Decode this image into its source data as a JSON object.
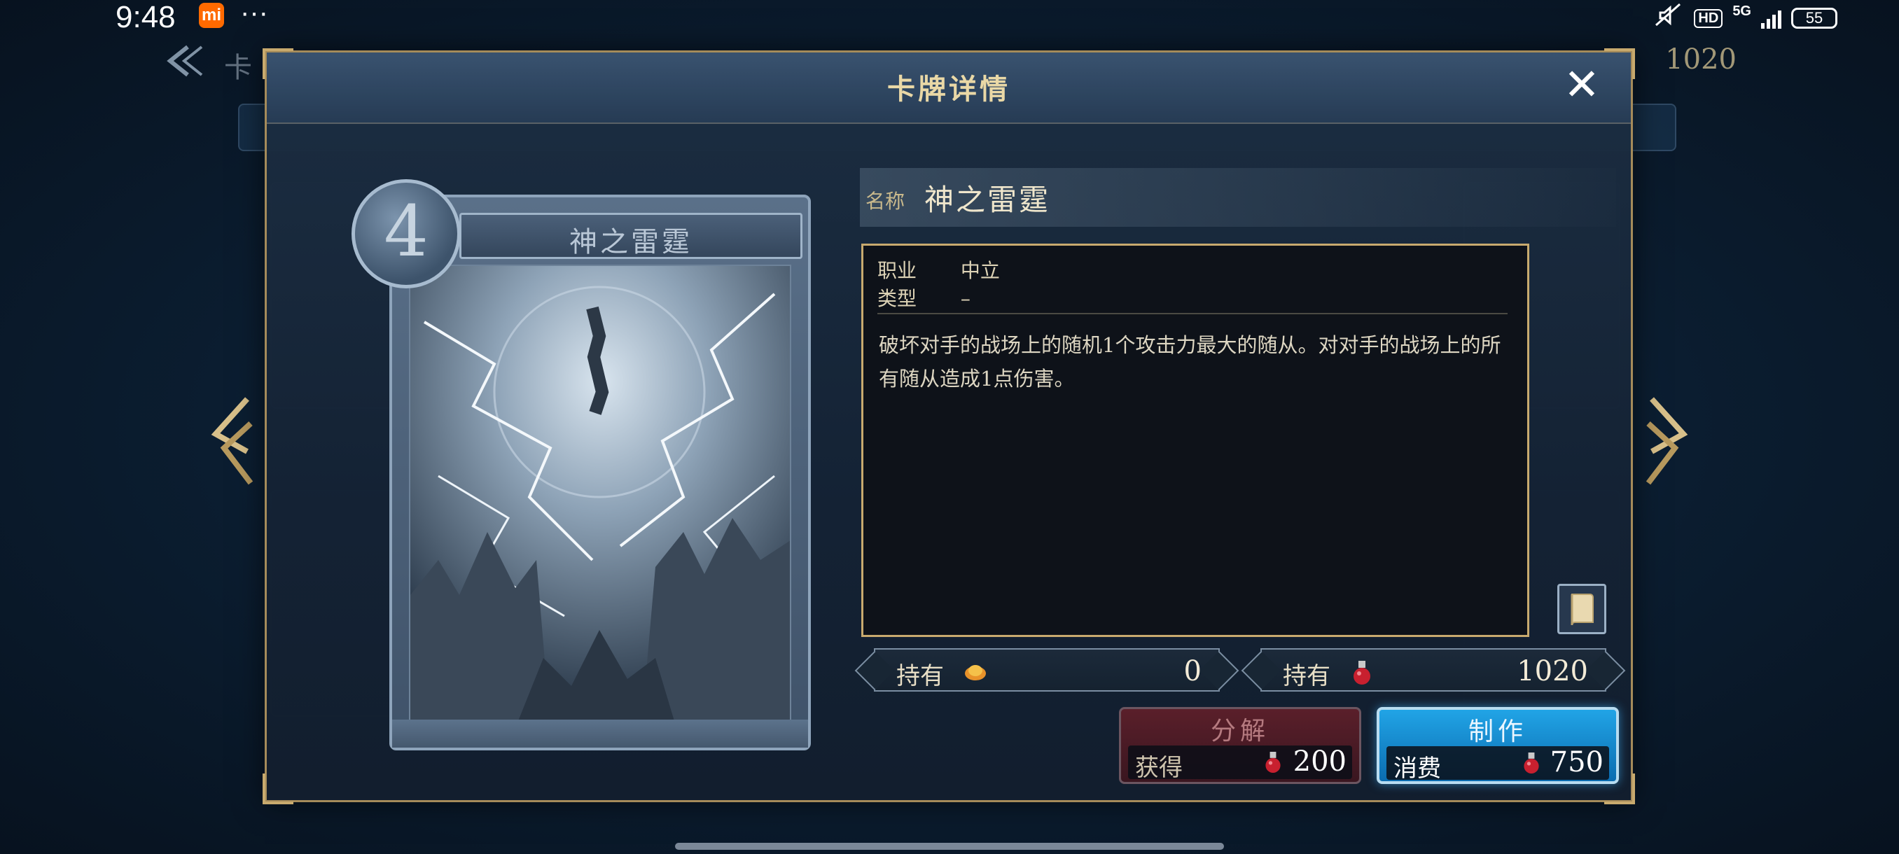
{
  "status_bar": {
    "time": "9:48",
    "app_badge": "mi",
    "more": "···",
    "hd": "HD",
    "network": "5G",
    "battery": "55"
  },
  "background": {
    "title_fragment": "卡",
    "currency_value": "1020"
  },
  "dialog": {
    "title": "卡牌详情",
    "close_symbol": "✕"
  },
  "card": {
    "cost": "4",
    "name": "神之雷霆"
  },
  "info": {
    "name_label": "名称",
    "name_value": "神之雷霆",
    "class_label": "职业",
    "class_value": "中立",
    "type_label": "类型",
    "type_value": "–",
    "description": "破坏对手的战场上的随机1个攻击力最大的随从。对对手的战场上的所有随从造成1点伤害。"
  },
  "owned": {
    "label": "持有",
    "card_count": "0",
    "vial_count": "1020"
  },
  "actions": {
    "disenchant": {
      "title": "分解",
      "sub_label": "获得",
      "value": "200"
    },
    "craft": {
      "title": "制作",
      "sub_label": "消费",
      "value": "750"
    }
  },
  "colors": {
    "gold_border": "#c8aa6e",
    "craft_blue": "#1f9ee0",
    "disenchant_red": "#5a1f2a"
  }
}
